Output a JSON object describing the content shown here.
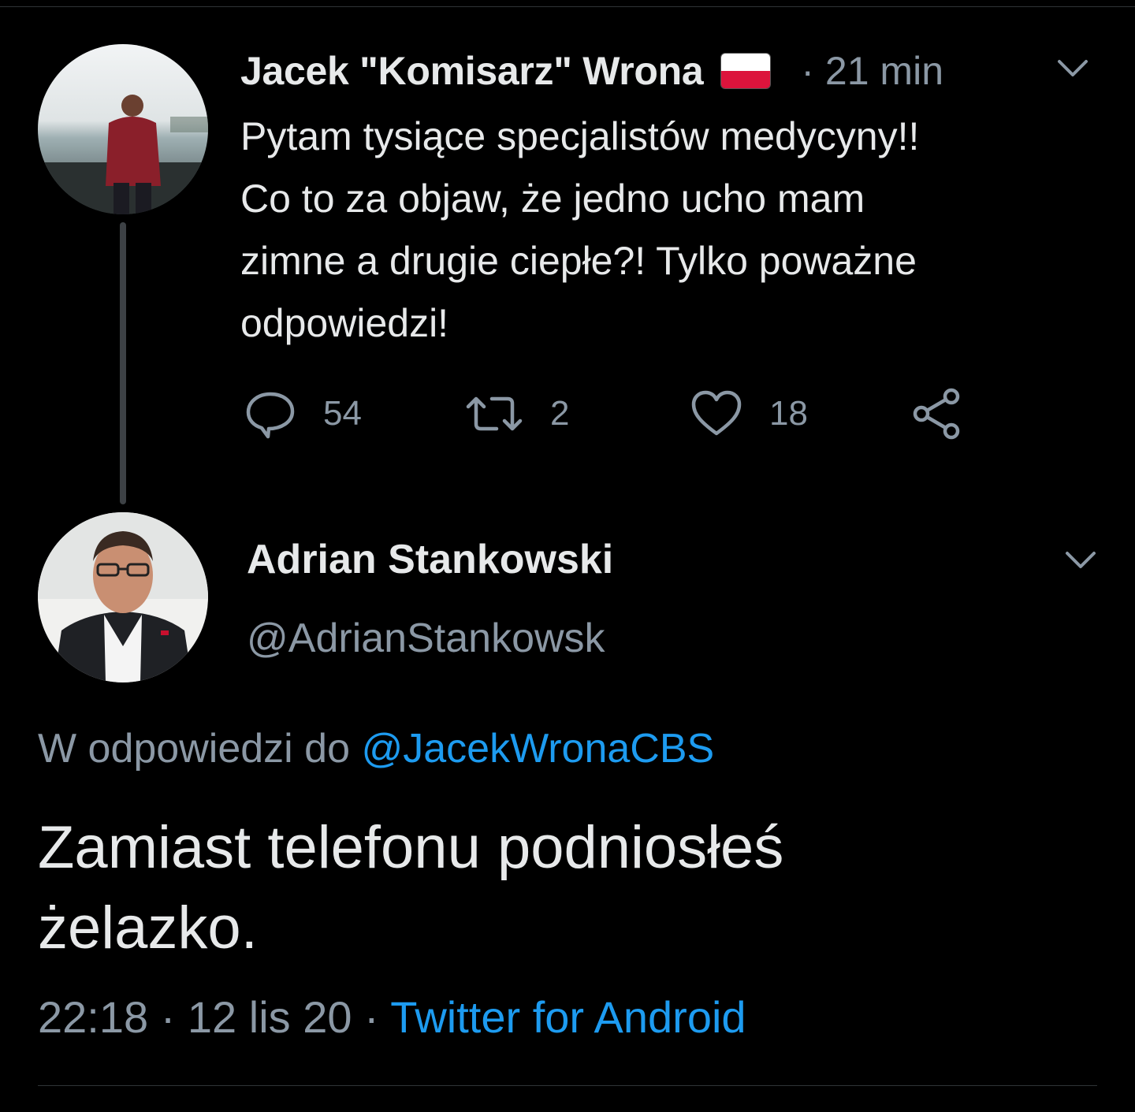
{
  "tweet1": {
    "author_name": "Jacek \"Komisarz\" Wrona",
    "time_sep": "·",
    "time": "21 min",
    "text": "Pytam tysiące specjalistów medycyny!!\nCo to za objaw, że jedno ucho mam\nzimne a drugie ciepłe?! Tylko poważne\nodpowiedzi!",
    "actions": {
      "reply_count": "54",
      "retweet_count": "2",
      "like_count": "18"
    }
  },
  "tweet2": {
    "author_name": "Adrian Stankowski",
    "handle": "@AdrianStankowsk",
    "reply_prefix": "W odpowiedzi do ",
    "reply_mention": "@JacekWronaCBS",
    "text": "Zamiast telefonu podniosłeś\nżelazko.",
    "time": "22:18",
    "sep": " · ",
    "date": "12 lis 20",
    "sep2": " · ",
    "source": "Twitter for Android"
  },
  "colors": {
    "background": "#000000",
    "text_primary": "#e7e9ea",
    "text_secondary": "#8b98a5",
    "link": "#1d9bf0"
  },
  "icons": {
    "reply": "speech-bubble-icon",
    "retweet": "retweet-arrows-icon",
    "like": "heart-icon",
    "share": "share-nodes-icon",
    "more": "chevron-down-icon",
    "flag": "poland-flag-icon"
  }
}
